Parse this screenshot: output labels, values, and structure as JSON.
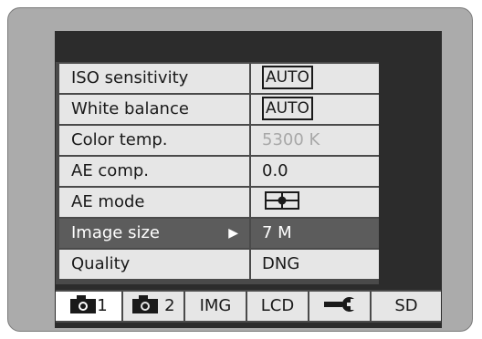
{
  "menu": {
    "items": [
      {
        "label": "ISO sensitivity",
        "value": "AUTO",
        "boxed": true,
        "disabled": false,
        "selected": false
      },
      {
        "label": "White balance",
        "value": "AUTO",
        "boxed": true,
        "disabled": false,
        "selected": false
      },
      {
        "label": "Color temp.",
        "value": "5300 K",
        "boxed": false,
        "disabled": true,
        "selected": false
      },
      {
        "label": "AE comp.",
        "value": "0.0",
        "boxed": false,
        "disabled": false,
        "selected": false
      },
      {
        "label": "AE mode",
        "value": "",
        "icon": "center-weighted-metering-icon",
        "boxed": false,
        "disabled": false,
        "selected": false
      },
      {
        "label": "Image size",
        "value": "7 M",
        "boxed": false,
        "disabled": false,
        "selected": true,
        "arrow": "▶"
      },
      {
        "label": "Quality",
        "value": "DNG",
        "boxed": false,
        "disabled": false,
        "selected": false
      }
    ]
  },
  "tabs": [
    {
      "label": "1",
      "icon": "camera-icon",
      "active": true
    },
    {
      "label": "2",
      "icon": "camera-icon",
      "active": false
    },
    {
      "label": "IMG",
      "active": false
    },
    {
      "label": "LCD",
      "active": false
    },
    {
      "label": "",
      "icon": "wrench-icon",
      "active": false
    },
    {
      "label": "SD",
      "active": false
    }
  ],
  "colors": {
    "frame": "#ababab",
    "screen": "#2c2c2c",
    "row": "#e6e6e6",
    "selected_row": "#5c5c5c"
  }
}
